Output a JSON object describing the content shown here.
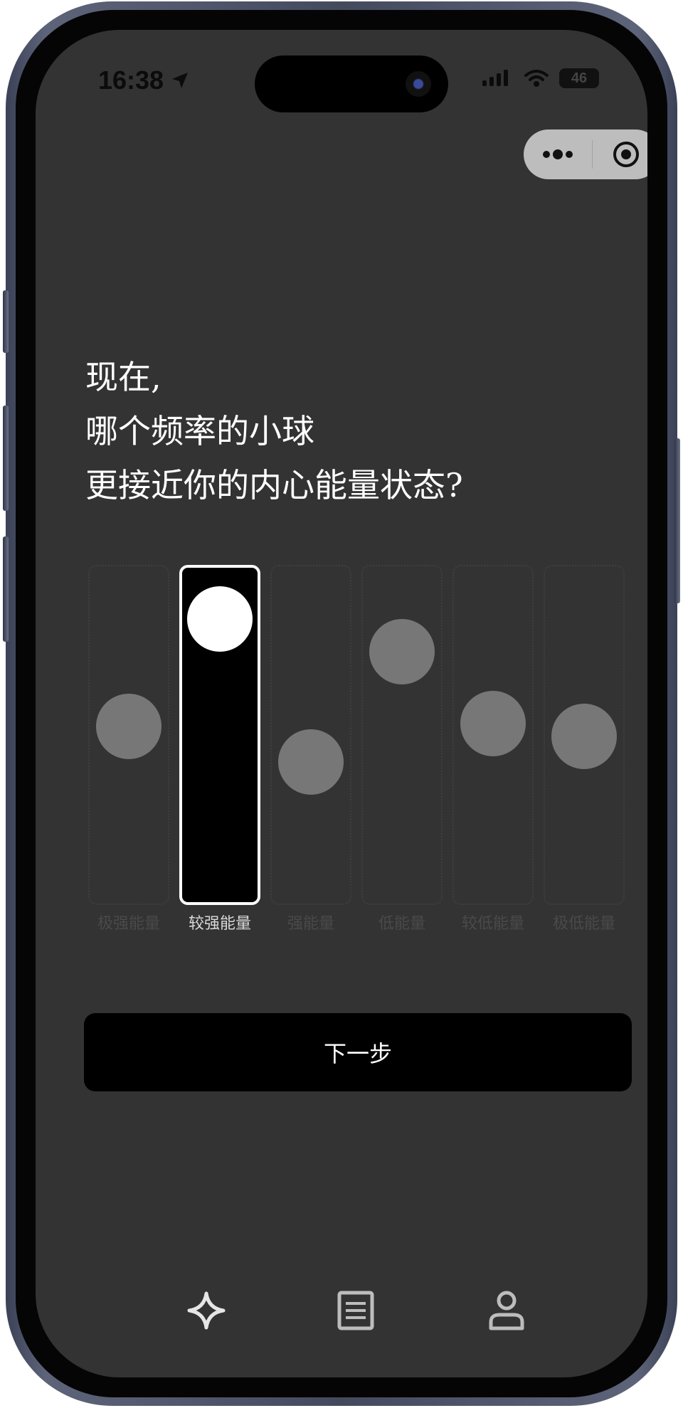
{
  "status_bar": {
    "time": "16:38",
    "battery": "46",
    "location_icon": "location-arrow-icon",
    "signal_icon": "cellular-signal-icon",
    "wifi_icon": "wifi-icon"
  },
  "mini_program_capsule": {
    "menu_icon": "more-dots-icon",
    "close_icon": "target-close-icon"
  },
  "question": {
    "lines": [
      "现在,",
      "哪个频率的小球",
      "更接近你的内心能量状态?"
    ]
  },
  "energy_options": [
    {
      "label": "极强能量",
      "ball_level": 0.54,
      "selected": false
    },
    {
      "label": "较强能量",
      "ball_level": 0.96,
      "selected": true
    },
    {
      "label": "强能量",
      "ball_level": 0.4,
      "selected": false
    },
    {
      "label": "低能量",
      "ball_level": 0.83,
      "selected": false
    },
    {
      "label": "较低能量",
      "ball_level": 0.55,
      "selected": false
    },
    {
      "label": "极低能量",
      "ball_level": 0.5,
      "selected": false
    }
  ],
  "next_button": {
    "label": "下一步"
  },
  "tab_bar": {
    "items": [
      {
        "icon": "sparkle-icon",
        "active": true
      },
      {
        "icon": "document-list-icon",
        "active": false
      },
      {
        "icon": "user-profile-icon",
        "active": false
      }
    ]
  },
  "colors": {
    "screen_background": "#333333",
    "selected_column": "#000000",
    "selected_ball": "#ffffff",
    "ball": "#777777",
    "button_background": "#000000"
  }
}
